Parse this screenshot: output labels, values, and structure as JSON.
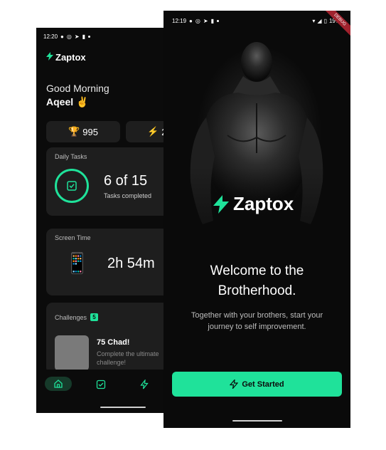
{
  "back": {
    "status_time": "12:20",
    "brand": "Zaptox",
    "greeting": "Good Morning",
    "user_name": "Aqeel ✌️",
    "stats": [
      {
        "icon": "trophy-icon",
        "glyph": "🏆",
        "value": "995"
      },
      {
        "icon": "bolt-icon",
        "glyph": "⚡",
        "value": "2"
      }
    ],
    "daily_tasks": {
      "title": "Daily Tasks",
      "count_text": "6 of 15",
      "sub": "Tasks completed"
    },
    "screen_time": {
      "title": "Screen Time",
      "value": "2h 54m"
    },
    "challenges": {
      "title": "Challenges",
      "badge": "5",
      "item_name": "75 Chad!",
      "item_desc": "Complete the ultimate challenge!"
    }
  },
  "front": {
    "status_time": "12:19",
    "battery": "19%",
    "debug_label": "DEBUG",
    "brand": "Zaptox",
    "welcome_line1": "Welcome to the",
    "welcome_line2": "Brotherhood.",
    "subtitle_line1": "Together with your brothers, start your",
    "subtitle_line2": "journey to self improvement.",
    "cta_label": "Get Started"
  },
  "colors": {
    "accent": "#1fe29a",
    "background": "#0b0b0b",
    "card": "#1e1e1e"
  }
}
